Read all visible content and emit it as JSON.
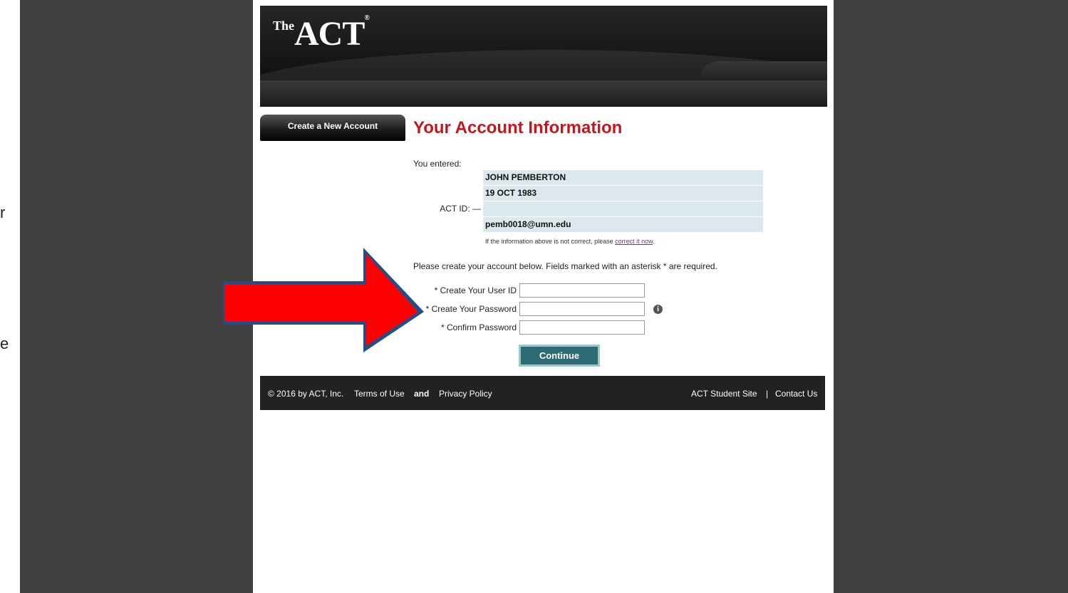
{
  "slide": {
    "left_fragment_1": "r",
    "left_fragment_2": "e"
  },
  "header": {
    "logo_the": "The",
    "logo_act": "ACT",
    "logo_reg": "®"
  },
  "sidebar": {
    "tab_label": "Create a New Account"
  },
  "main": {
    "title": "Your Account Information",
    "you_entered": "You entered:",
    "entered_info": [
      "JOHN PEMBERTON",
      "19 OCT 1983",
      "",
      "pemb0018@umn.edu"
    ],
    "act_id_label": "ACT ID: —",
    "correction_text": "If the information above is not correct, please",
    "correction_link": "correct it now",
    "correction_end": ".",
    "instructions": "Please create your account below. Fields marked with an asterisk * are required."
  },
  "form": {
    "user_id_label": "* Create Your User ID",
    "user_id_value": "",
    "password_label": "* Create Your Password",
    "password_value": "",
    "confirm_label": "* Confirm Password",
    "confirm_value": "",
    "info_icon_glyph": "i",
    "continue_label": "Continue"
  },
  "footer": {
    "copyright": "© 2016 by ACT, Inc.",
    "terms": "Terms of Use",
    "and": "and",
    "privacy": "Privacy Policy",
    "student_site": "ACT Student Site",
    "separator": "|",
    "contact": "Contact Us"
  },
  "colors": {
    "title_red": "#c5161d",
    "arrow_red": "#ff0000",
    "arrow_outline": "#1f4e8c",
    "button_teal": "#2d6a73",
    "info_bg": "#dbe9ee"
  },
  "icons": {
    "arrow": "right-arrow-icon",
    "info": "info-icon"
  }
}
